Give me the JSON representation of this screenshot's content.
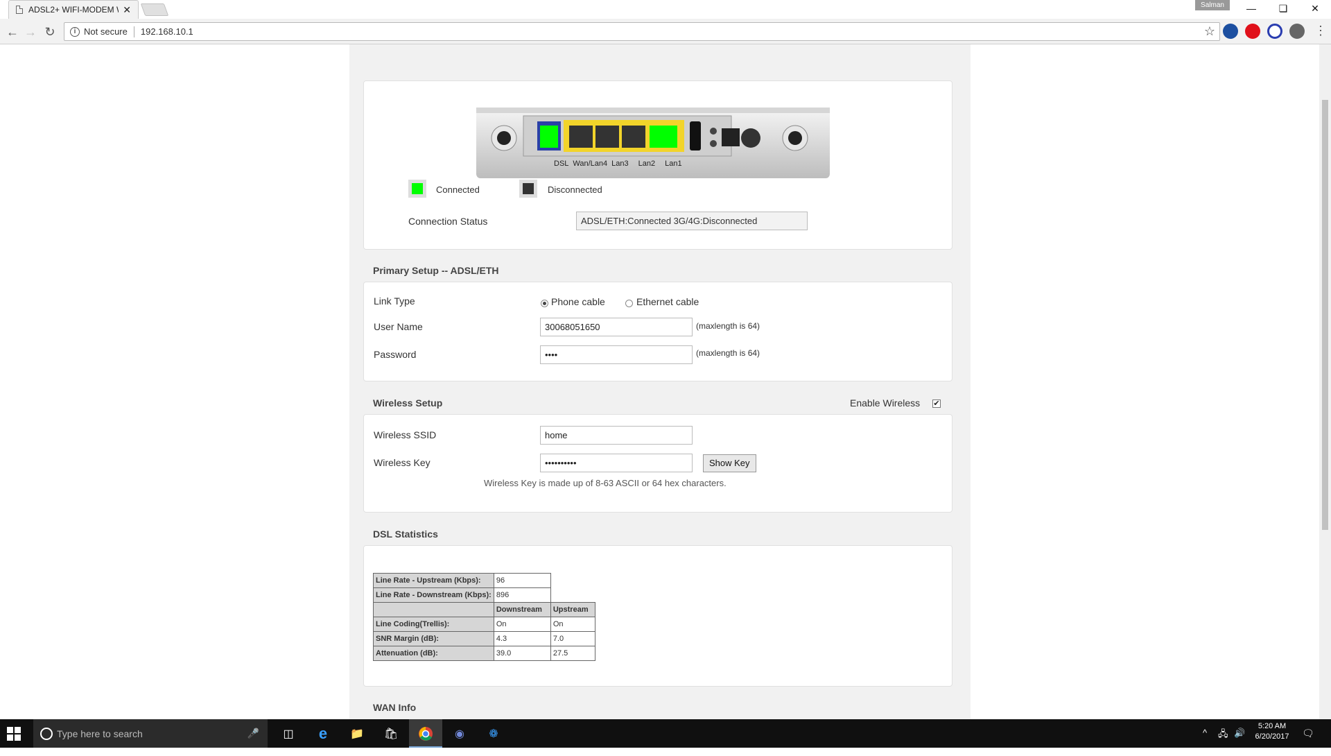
{
  "browser": {
    "tab_title": "ADSL2+ WIFI-MODEM W",
    "tab_close": "✕",
    "user_name": "Salman",
    "security_label": "Not secure",
    "url": "192.168.10.1"
  },
  "router_panel": {
    "port_labels": [
      "DSL",
      "Wan/Lan4",
      "Lan3",
      "Lan2",
      "Lan1"
    ],
    "legend_connected": "Connected",
    "legend_disconnected": "Disconnected",
    "connection_status_label": "Connection Status",
    "connection_status_value": "ADSL/ETH:Connected  3G/4G:Disconnected"
  },
  "primary_setup": {
    "title": "Primary Setup -- ADSL/ETH",
    "link_type_label": "Link Type",
    "link_options": [
      "Phone cable",
      "Ethernet cable"
    ],
    "link_selected": "Phone cable",
    "user_name_label": "User Name",
    "user_name_value": "30068051650",
    "password_label": "Password",
    "password_value": "••••",
    "maxlength_hint": "(maxlength is 64)"
  },
  "wireless_setup": {
    "title": "Wireless Setup",
    "enable_label": "Enable Wireless",
    "enable_checked": true,
    "ssid_label": "Wireless SSID",
    "ssid_value": "home",
    "key_label": "Wireless Key",
    "key_value": "••••••••••",
    "show_key_button": "Show Key",
    "key_hint": "Wireless Key is made up of 8-63 ASCII or 64 hex characters."
  },
  "dsl_statistics": {
    "title": "DSL Statistics",
    "upstream_rate_label": "Line Rate - Upstream (Kbps):",
    "upstream_rate": "96",
    "downstream_rate_label": "Line Rate - Downstream (Kbps):",
    "downstream_rate": "896",
    "col_downstream": "Downstream",
    "col_upstream": "Upstream",
    "rows": [
      {
        "label": "Line Coding(Trellis):",
        "down": "On",
        "up": "On"
      },
      {
        "label": "SNR Margin (dB):",
        "down": "4.3",
        "up": "7.0"
      },
      {
        "label": "Attenuation (dB):",
        "down": "39.0",
        "up": "27.5"
      }
    ]
  },
  "wan_info": {
    "title": "WAN Info"
  },
  "taskbar": {
    "search_placeholder": "Type here to search",
    "time": "5:20 AM",
    "date": "6/20/2017"
  },
  "colors": {
    "connected": "#00ff00",
    "disconnected": "#333333",
    "lan_band": "#f2d42a",
    "page_bg": "#f1f1f1"
  }
}
